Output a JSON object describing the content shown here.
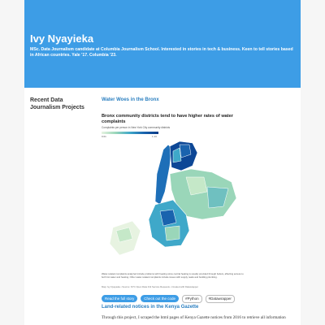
{
  "colors": {
    "page_background": "#f6f6f6",
    "header_background": "#3d9de6",
    "accent": "#3d9de6",
    "link": "#2b7fc0"
  },
  "header": {
    "name": "Ivy Nyayieka",
    "bio": "MSc. Data Journalism candidate at Columbia Journalism School. Interested in stories in tech & business. Keen to tell stories based in African countries. Yale '17. Columbia '23."
  },
  "sidebar": {
    "title": "Recent Data Journalism Projects"
  },
  "projects": [
    {
      "title": "Water Woes in the Bronx",
      "map": {
        "title": "Bronx community districts tend to have higher rates of water complaints",
        "subtitle": "Complaints per person in New York City community districts",
        "legend_min": "0.01",
        "legend_max": "1.13",
        "note": "Water-related complaints analyzed include problems with heating since central heating is usually provided through boilers, affecting access to both hot water and heating. Other water-related complaints include issues with supply, leaks and building plumbing.",
        "source": "Map: Ivy Nyayieka • Source: NYC Open Data 311 Service Requests • Created with Datawrapper"
      },
      "buttons": [
        "Read the full story",
        "Check out the code"
      ],
      "tags": [
        "#Python",
        "#Datawrapper"
      ]
    },
    {
      "title": "Land-related notices in the Kenya Gazette",
      "description": "Through this project, I scraped the html pages of Kenya Gazette notices from 2016 to retrieve all information"
    }
  ]
}
